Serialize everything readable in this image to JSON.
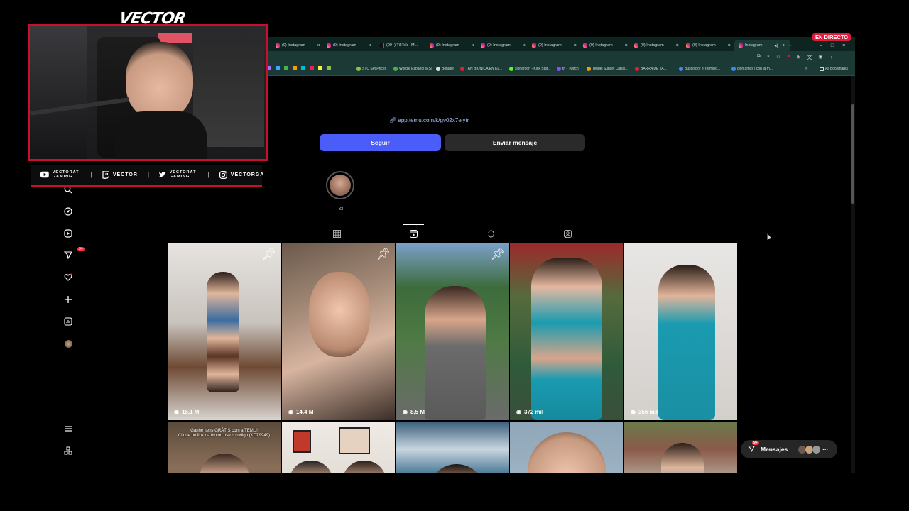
{
  "stream": {
    "brand": "VECTOR",
    "live_badge": "EN DIRECTO",
    "socials": [
      {
        "icon": "youtube-icon",
        "label": "VECTORAT GAMING"
      },
      {
        "icon": "twitch-icon",
        "label": "VECTOR"
      },
      {
        "icon": "twitter-icon",
        "label": "VECTORAT GAMING"
      },
      {
        "icon": "instagram-icon",
        "label": "VECTORGA"
      }
    ]
  },
  "browser": {
    "tabs": [
      {
        "label": "(9) Instagram"
      },
      {
        "label": "(9) Instagram"
      },
      {
        "label": "(99+) TikTok - M..."
      },
      {
        "label": "(9) Instagram"
      },
      {
        "label": "(9) Instagram"
      },
      {
        "label": "(9) Instagram"
      },
      {
        "label": "(9) Instagram"
      },
      {
        "label": "(9) Instagram"
      },
      {
        "label": "(9) Instagram"
      },
      {
        "label": "Instagram"
      }
    ],
    "bookmarks": [
      "STC Set Prices",
      "Wordle Español (ES)",
      "Botudle",
      "TAN BIONICA EN EL...",
      "sionaroon - Kick Stat...",
      "tn - Twitch",
      "Tenuki Sunset Classi...",
      "BARRA DE TA...",
      "Buscó por el término...",
      "cion amos | con la m..."
    ],
    "all_bookmarks": "All Bookmarks"
  },
  "profile": {
    "bio_link": "app.temu.com/k/gv02x7eiytr",
    "follow_label": "Seguir",
    "message_label": "Enviar mensaje",
    "highlight_label": "33"
  },
  "posts": [
    {
      "views": "15,1 M",
      "pinned": true
    },
    {
      "views": "14,4 M",
      "pinned": true
    },
    {
      "views": "8,5 M",
      "pinned": true
    },
    {
      "views": "372 mil",
      "pinned": false
    },
    {
      "views": "356 mil",
      "pinned": false
    },
    {
      "views": "",
      "pinned": false,
      "caption": "Ganhe itens GRÁTIS com a TEMU!\nClique no link da bio ou use o código (KCZ9949)"
    },
    {
      "views": "",
      "pinned": false
    },
    {
      "views": "",
      "pinned": false
    },
    {
      "views": "",
      "pinned": false
    },
    {
      "views": "",
      "pinned": false
    }
  ],
  "sidebar": {
    "notifications_badge": "9+"
  },
  "messages_pill": {
    "label": "Mensajes",
    "badge": "9+"
  },
  "colors": {
    "accent": "#4a5df9",
    "live": "#e21b3c",
    "cam_border": "#c8102e",
    "browser_chrome": "#1b3a35"
  }
}
